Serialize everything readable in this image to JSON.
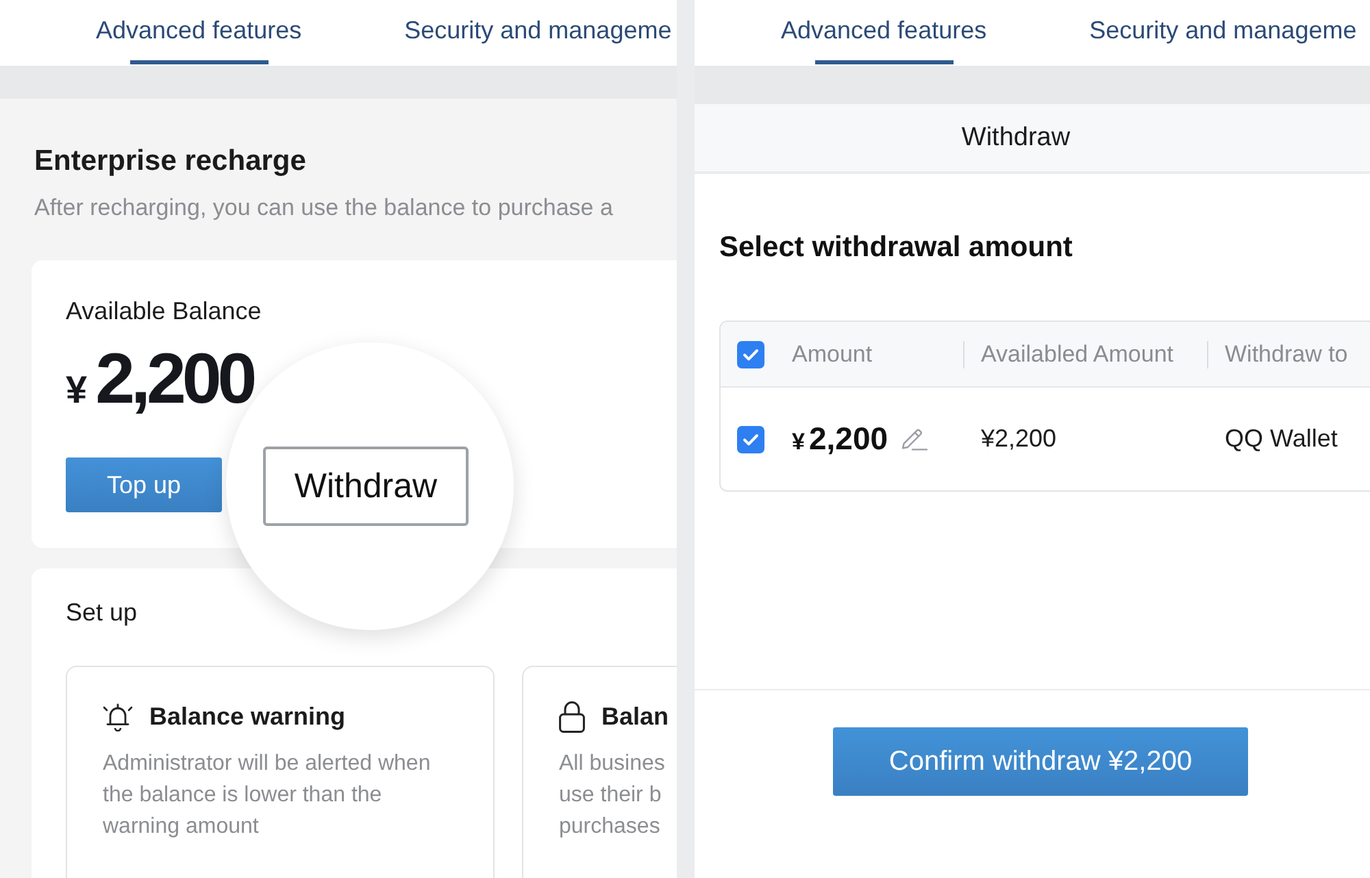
{
  "left_screen": {
    "tabs": [
      {
        "label": "Advanced features",
        "selected": true
      },
      {
        "label": "Security and manageme",
        "selected": false
      }
    ],
    "title": "Enterprise recharge",
    "subtitle": "After recharging, you can use the balance to purchase a",
    "balance_card": {
      "label": "Available Balance",
      "currency": "¥",
      "amount": "2,200",
      "buttons": [
        {
          "label": "Top up",
          "kind": "primary",
          "magnified": false
        },
        {
          "label": "Withdraw",
          "kind": "outline",
          "magnified": true
        }
      ]
    },
    "setup_card": {
      "title": "Set up",
      "options": [
        {
          "kind": "alert",
          "title": "Balance warning",
          "description_lines": [
            "Administrator will be alerted when",
            "the balance is lower than the",
            "warning amount"
          ]
        },
        {
          "kind": "lock",
          "title": "Balan",
          "description_lines": [
            "All busines",
            "use their b",
            "purchases"
          ]
        }
      ]
    }
  },
  "right_screen": {
    "tabs": [
      {
        "label": "Advanced features",
        "selected": true
      },
      {
        "label": "Security and manageme",
        "selected": false
      }
    ],
    "dialog": {
      "title": "Withdraw",
      "heading": "Select withdrawal amount",
      "table": {
        "select_all_checked": true,
        "columns": [
          "Amount",
          "Availabled Amount",
          "Withdraw to"
        ],
        "rows": [
          {
            "checked": true,
            "currency": "¥",
            "amount": "2,200",
            "editable": true,
            "available": "¥2,200",
            "withdraw_to": "QQ Wallet"
          }
        ]
      },
      "confirm_button": "Confirm withdraw ¥2,200"
    }
  }
}
